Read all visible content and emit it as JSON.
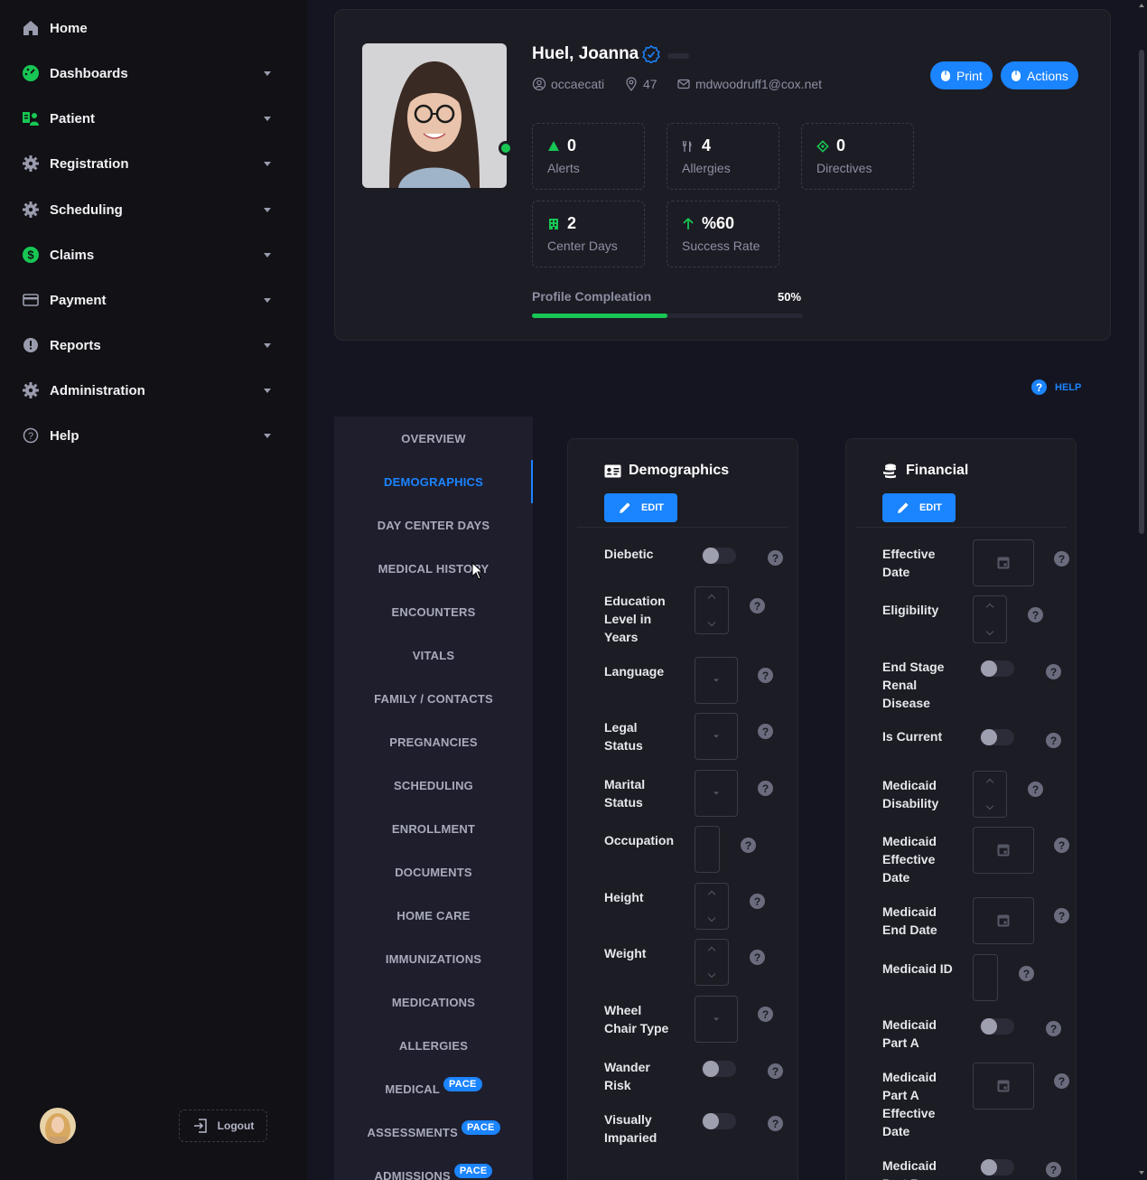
{
  "sidebar": {
    "items": [
      {
        "label": "Home",
        "icon": "home-icon",
        "caret": false
      },
      {
        "label": "Dashboards",
        "icon": "dashboard-gauge-icon",
        "caret": true
      },
      {
        "label": "Patient",
        "icon": "patient-icon",
        "caret": true
      },
      {
        "label": "Registration",
        "icon": "gear-icon",
        "caret": true
      },
      {
        "label": "Scheduling",
        "icon": "gear-icon",
        "caret": true
      },
      {
        "label": "Claims",
        "icon": "dollar-icon",
        "caret": true
      },
      {
        "label": "Payment",
        "icon": "credit-card-icon",
        "caret": true
      },
      {
        "label": "Reports",
        "icon": "alert-circle-icon",
        "caret": true
      },
      {
        "label": "Administration",
        "icon": "gear-icon",
        "caret": true
      },
      {
        "label": "Help",
        "icon": "question-circle-icon",
        "caret": true
      }
    ],
    "logout_label": "Logout"
  },
  "profile": {
    "name": "Huel, Joanna",
    "username": "occaecati",
    "location": "47",
    "email": "mdwoodruff1@cox.net",
    "print_label": "Print",
    "actions_label": "Actions",
    "stats": [
      {
        "value": "0",
        "label": "Alerts",
        "icon": "warning-triangle-icon",
        "color": "#17c653"
      },
      {
        "value": "4",
        "label": "Allergies",
        "icon": "fork-knife-icon",
        "color": "#8c8fa3"
      },
      {
        "value": "0",
        "label": "Directives",
        "icon": "target-icon",
        "color": "#17c653"
      },
      {
        "value": "2",
        "label": "Center Days",
        "icon": "building-icon",
        "color": "#17c653"
      },
      {
        "value": "%60",
        "label": "Success Rate",
        "icon": "arrow-up-icon",
        "color": "#17c653"
      }
    ],
    "completion_label": "Profile Compleation",
    "completion_pct_text": "50%",
    "completion_fraction": 0.5
  },
  "help_label": "HELP",
  "tabs": [
    {
      "label": "OVERVIEW",
      "active": false,
      "pace": ""
    },
    {
      "label": "DEMOGRAPHICS",
      "active": true,
      "pace": ""
    },
    {
      "label": "DAY CENTER DAYS",
      "active": false,
      "pace": ""
    },
    {
      "label": "MEDICAL HISTORY",
      "active": false,
      "pace": ""
    },
    {
      "label": "ENCOUNTERS",
      "active": false,
      "pace": ""
    },
    {
      "label": "VITALS",
      "active": false,
      "pace": ""
    },
    {
      "label": "FAMILY / CONTACTS",
      "active": false,
      "pace": ""
    },
    {
      "label": "PREGNANCIES",
      "active": false,
      "pace": ""
    },
    {
      "label": "SCHEDULING",
      "active": false,
      "pace": ""
    },
    {
      "label": "ENROLLMENT",
      "active": false,
      "pace": ""
    },
    {
      "label": "DOCUMENTS",
      "active": false,
      "pace": ""
    },
    {
      "label": "HOME CARE",
      "active": false,
      "pace": ""
    },
    {
      "label": "IMMUNIZATIONS",
      "active": false,
      "pace": ""
    },
    {
      "label": "MEDICATIONS",
      "active": false,
      "pace": ""
    },
    {
      "label": "ALLERGIES",
      "active": false,
      "pace": ""
    },
    {
      "label": "MEDICAL",
      "active": false,
      "pace": "PACE"
    },
    {
      "label": "ASSESSMENTS",
      "active": false,
      "pace": "PACE"
    },
    {
      "label": "ADMISSIONS",
      "active": false,
      "pace": "PACE"
    }
  ],
  "demographics": {
    "title": "Demographics",
    "edit_label": "EDIT",
    "fields": [
      {
        "label": "Diebetic",
        "kind": "toggle"
      },
      {
        "label": "Education Level in Years",
        "kind": "number"
      },
      {
        "label": "Language",
        "kind": "select"
      },
      {
        "label": "Legal Status",
        "kind": "select"
      },
      {
        "label": "Marital Status",
        "kind": "select"
      },
      {
        "label": "Occupation",
        "kind": "text"
      },
      {
        "label": "Height",
        "kind": "number"
      },
      {
        "label": "Weight",
        "kind": "number"
      },
      {
        "label": "Wheel Chair Type",
        "kind": "select"
      },
      {
        "label": "Wander Risk",
        "kind": "toggle"
      },
      {
        "label": "Visually Imparied",
        "kind": "toggle"
      }
    ]
  },
  "financial": {
    "title": "Financial",
    "edit_label": "EDIT",
    "fields": [
      {
        "label": "Effective Date",
        "kind": "date"
      },
      {
        "label": "Eligibility",
        "kind": "number"
      },
      {
        "label": "End Stage Renal Disease",
        "kind": "toggle"
      },
      {
        "label": "Is Current",
        "kind": "toggle"
      },
      {
        "label": "Medicaid Disability",
        "kind": "number"
      },
      {
        "label": "Medicaid Effective Date",
        "kind": "date"
      },
      {
        "label": "Medicaid End Date",
        "kind": "date"
      },
      {
        "label": "Medicaid ID",
        "kind": "text"
      },
      {
        "label": "Medicaid Part A",
        "kind": "toggle"
      },
      {
        "label": "Medicaid Part A Effective Date",
        "kind": "date"
      },
      {
        "label": "Medicaid Part B",
        "kind": "toggle"
      }
    ]
  }
}
